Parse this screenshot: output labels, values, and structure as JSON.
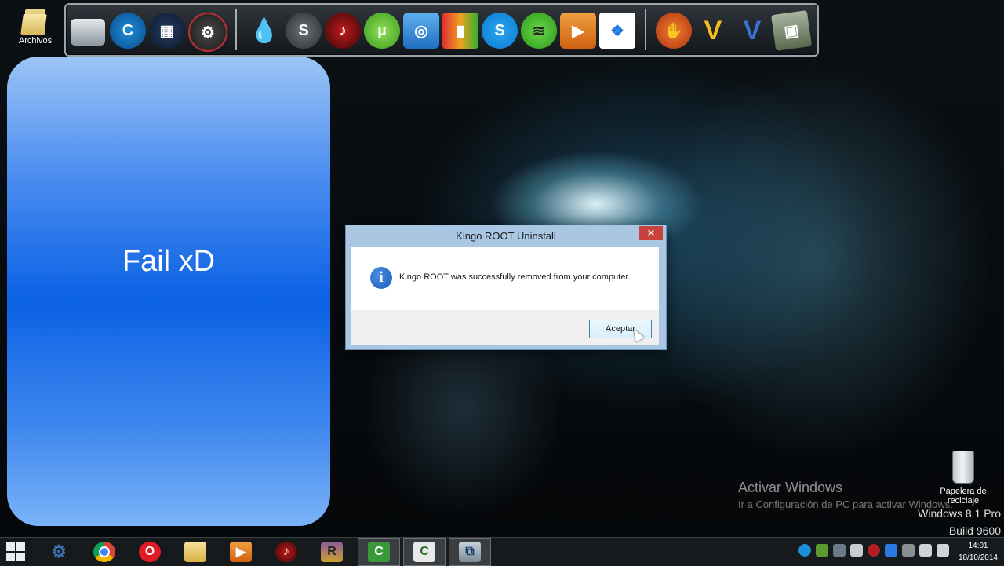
{
  "desktop": {
    "folder_label": "Archivos",
    "recycle_bin_label": "Papelera de reciclaje"
  },
  "dock": {
    "icons": [
      "drive-icon",
      "ccleaner-icon",
      "color-grid-icon",
      "gear-game-icon",
      "water-drop-icon",
      "steam-icon",
      "music-disc-icon",
      "utorrent-icon",
      "disc-app-icon",
      "blocks-app-icon",
      "skype-icon",
      "spotify-icon",
      "media-player-icon",
      "dropbox-icon",
      "paw-app-icon",
      "vegas-v-icon",
      "video-v-icon",
      "camtasia-icon"
    ]
  },
  "side_panel": {
    "caption": "Fail xD"
  },
  "dialog": {
    "title": "Kingo ROOT Uninstall",
    "close_glyph": "✕",
    "info_glyph": "i",
    "message": "Kingo ROOT was successfully removed from your computer.",
    "ok_label": "Aceptar"
  },
  "watermark": {
    "title": "Activar Windows",
    "subtitle": "Ir a Configuración de PC para activar Windows.",
    "edition": "Windows 8.1 Pro",
    "build": "Build 9600"
  },
  "taskbar": {
    "items": [
      "start-icon",
      "settings-gear-icon",
      "chrome-icon",
      "opera-icon",
      "file-explorer-icon",
      "media-player-icon",
      "music-disc-icon",
      "winrar-icon",
      "camtasia-icon",
      "camtasia-recorder-icon",
      "installer-icon"
    ],
    "clock_time": "14:01",
    "clock_date": "18/10/2014"
  },
  "colors": {
    "panel_blue": "#0b61e4",
    "dialog_frame": "#a9c7e3",
    "close_red": "#c7423a"
  }
}
